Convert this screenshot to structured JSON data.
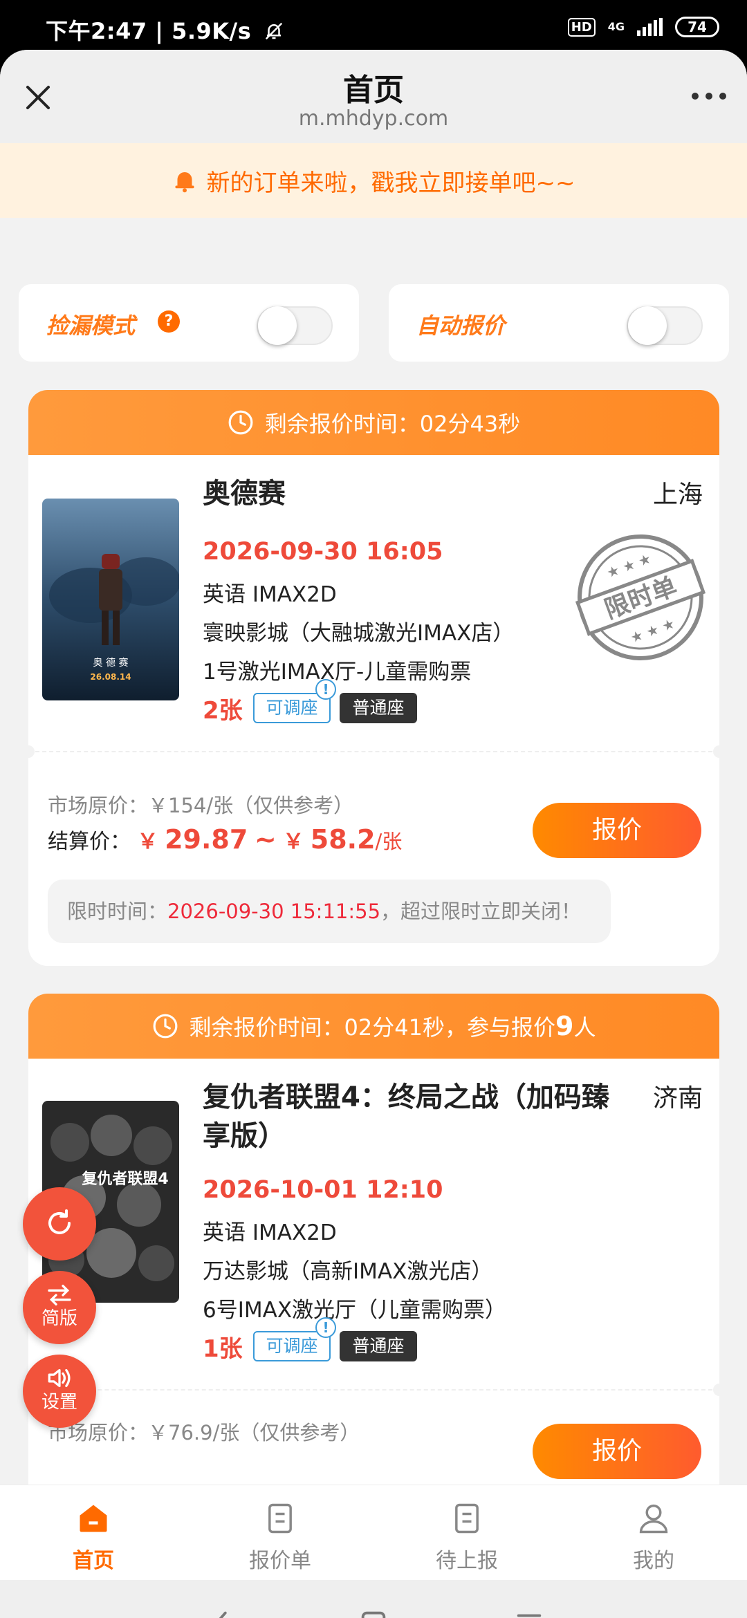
{
  "status_bar": {
    "time_speed": "下午2:47 | 5.9K/s",
    "hd_badge": "HD",
    "network": "4G",
    "battery": "74",
    "icons": [
      "bell-muted-icon",
      "signal-icon"
    ]
  },
  "header": {
    "title": "首页",
    "url": "m.mhdyp.com",
    "icons": [
      "close-icon",
      "more-icon"
    ]
  },
  "notice": {
    "text": "新的订单来啦，戳我立即接单吧~~",
    "icon": "bell-icon"
  },
  "modes": {
    "leak_mode_label": "捡漏模式",
    "auto_quote_label": "自动报价",
    "help_glyph": "?",
    "leak_mode_on": false,
    "auto_quote_on": false
  },
  "orders": [
    {
      "timer_text": "剩余报价时间：02分43秒",
      "title": "奥德赛",
      "city": "上海",
      "show_time": "2026-09-30 16:05",
      "format": "英语 IMAX2D",
      "cinema": "寰映影城（大融城激光IMAX店）",
      "hall": "1号激光IMAX厅-儿童需购票",
      "qty": "2张",
      "tag_adjustable": "可调座",
      "tag_info": "!",
      "tag_seat": "普通座",
      "stamp": "限时单",
      "poster_text": "奥 德 赛",
      "poster_date": "26.08.14",
      "market_price": "市场原价：￥154/张（仅供参考）",
      "settle_label": "结算价：",
      "yen": "￥",
      "price_low": "29.87",
      "tilde": "~",
      "price_high": "58.2",
      "unit": "/张",
      "button": "报价",
      "deadline_label": "限时时间：",
      "deadline_time": "2026-09-30 15:11:55",
      "deadline_suffix": "，超过限时立即关闭！"
    },
    {
      "timer_text": "剩余报价时间：02分41秒，参与报价",
      "participants": "9",
      "participants_unit": "人",
      "title": "复仇者联盟4：终局之战（加码臻享版）",
      "city": "济南",
      "show_time": "2026-10-01 12:10",
      "format": "英语 IMAX2D",
      "cinema": "万达影城（高新IMAX激光店）",
      "hall": "6号IMAX激光厅（儿童需购票）",
      "qty": "1张",
      "tag_adjustable": "可调座",
      "tag_info": "!",
      "tag_seat": "普通座",
      "poster_text": "复仇者联盟4",
      "market_price": "市场原价：￥76.9/张（仅供参考）",
      "button": "报价"
    }
  ],
  "floating": {
    "refresh_icon": "refresh-icon",
    "simple_label": "简版",
    "settings_label": "设置"
  },
  "tabs": [
    {
      "label": "首页",
      "icon": "home-icon",
      "active": true
    },
    {
      "label": "报价单",
      "icon": "quote-list-icon",
      "active": false
    },
    {
      "label": "待上报",
      "icon": "pending-report-icon",
      "active": false
    },
    {
      "label": "我的",
      "icon": "profile-icon",
      "active": false
    }
  ],
  "colors": {
    "accent": "#ff6a00",
    "price_red": "#ee4a3a",
    "timer_orange": "#ff8a25",
    "notice_bg": "#fff2df"
  }
}
